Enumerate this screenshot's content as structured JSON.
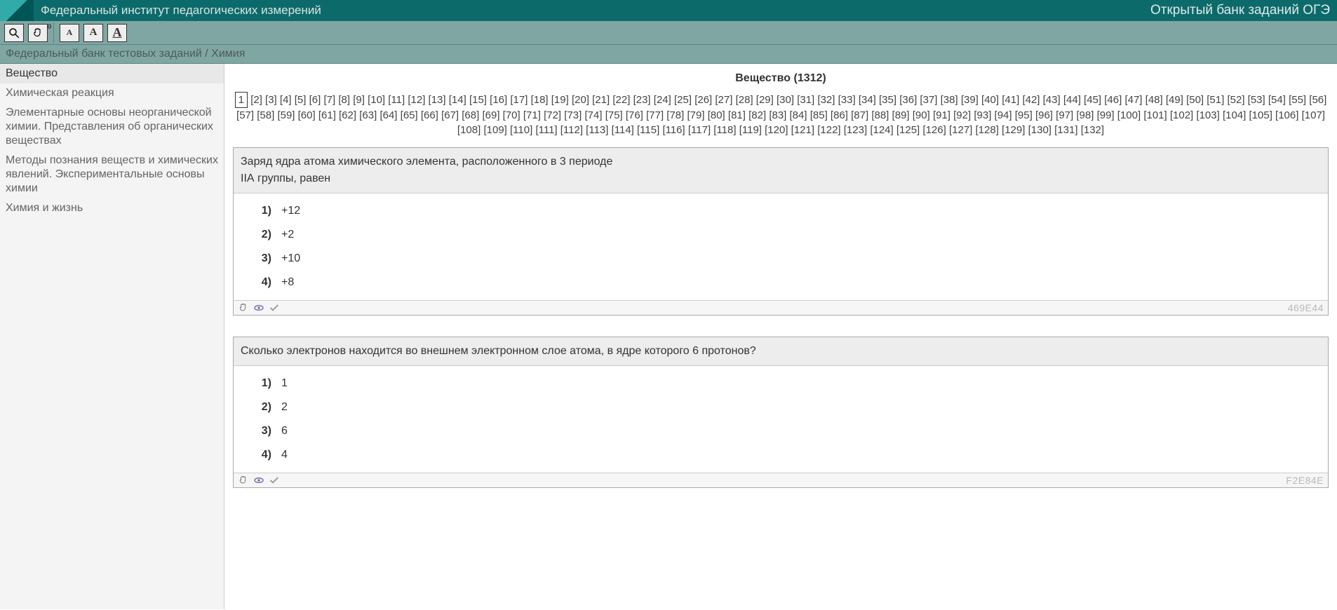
{
  "header": {
    "left": "Федеральный институт педагогических измерений",
    "right": "Открытый банк заданий ОГЭ"
  },
  "toolbar": {
    "hand_badge": "0",
    "font_a": "A",
    "font_b": "A",
    "font_c": "A"
  },
  "breadcrumb": "Федеральный банк тестовых заданий / Химия",
  "sidebar": {
    "items": [
      "Вещество",
      "Химическая реакция",
      "Элементарные основы неорганической химии. Представления об органических веществах",
      "Методы познания веществ и химических явлений. Экспериментальные основы химии",
      "Химия и жизнь"
    ],
    "active_index": 0
  },
  "section": {
    "title_prefix": "Вещество",
    "count": 1312
  },
  "pagination": {
    "current": 1,
    "total_pages": 132
  },
  "questions": [
    {
      "id": "469E44",
      "stem_lines": [
        "Заряд ядра атома химического элемента, расположенного в 3 периоде",
        "IIА группы, равен"
      ],
      "options": [
        "+12",
        "+2",
        "+10",
        "+8"
      ]
    },
    {
      "id": "F2E84E",
      "stem_lines": [
        "Сколько электронов находится во внешнем электронном слое атома, в ядре которого 6 протонов?"
      ],
      "options": [
        "1",
        "2",
        "6",
        "4"
      ]
    }
  ]
}
